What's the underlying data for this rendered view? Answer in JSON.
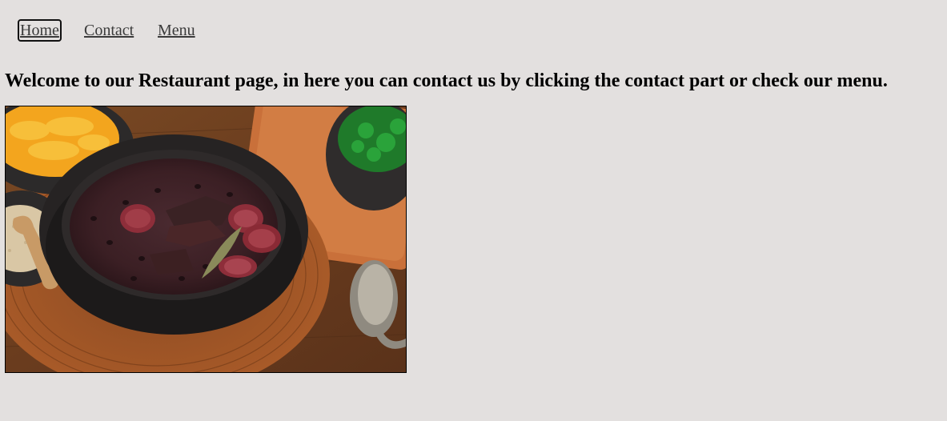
{
  "nav": {
    "items": [
      {
        "label": "Home",
        "active": true
      },
      {
        "label": "Contact",
        "active": false
      },
      {
        "label": "Menu",
        "active": false
      }
    ]
  },
  "main": {
    "heading": "Welcome to our Restaurant page, in here you can contact us by clicking the contact part or check our menu."
  },
  "colors": {
    "page_background": "#e3e0df",
    "link_color": "#3a3a3a"
  }
}
